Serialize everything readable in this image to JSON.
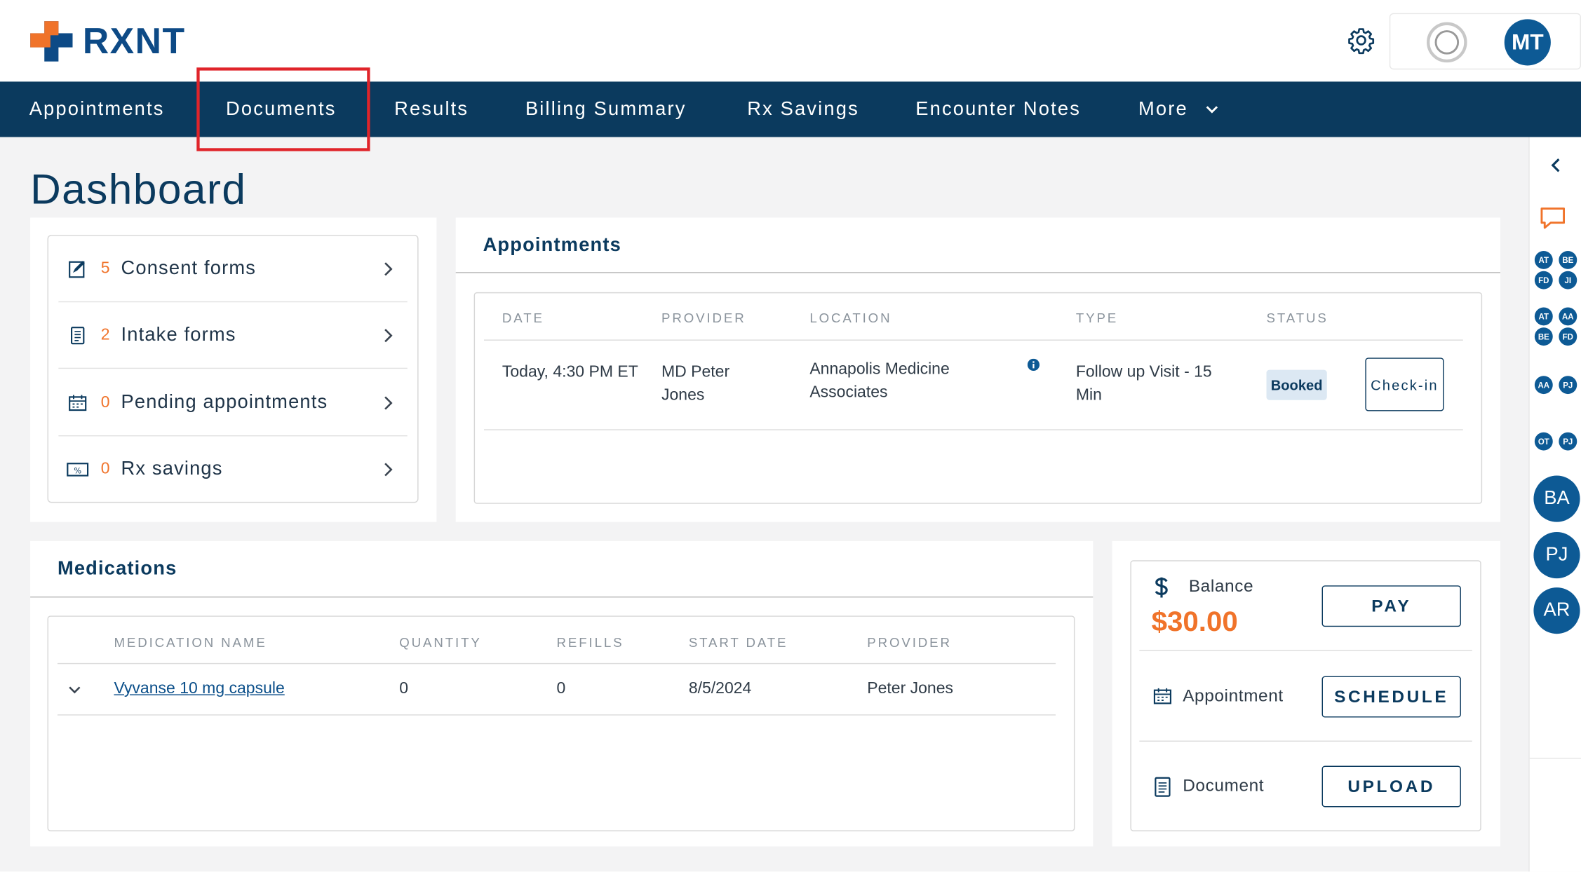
{
  "header": {
    "logo_text": "RXNT",
    "avatar_initials": "MT"
  },
  "nav": {
    "items": [
      {
        "label": "Appointments"
      },
      {
        "label": "Documents"
      },
      {
        "label": "Results"
      },
      {
        "label": "Billing Summary"
      },
      {
        "label": "Rx Savings"
      },
      {
        "label": "Encounter Notes"
      },
      {
        "label": "More"
      }
    ],
    "highlighted": "Documents"
  },
  "page": {
    "title": "Dashboard"
  },
  "summary": {
    "items": [
      {
        "count": "5",
        "label": "Consent forms",
        "icon": "consent-form-icon"
      },
      {
        "count": "2",
        "label": "Intake forms",
        "icon": "intake-form-icon"
      },
      {
        "count": "0",
        "label": "Pending appointments",
        "icon": "calendar-icon"
      },
      {
        "count": "0",
        "label": "Rx savings",
        "icon": "rx-savings-icon"
      }
    ]
  },
  "appointments": {
    "title": "Appointments",
    "columns": [
      "DATE",
      "PROVIDER",
      "LOCATION",
      "TYPE",
      "STATUS"
    ],
    "rows": [
      {
        "date": "Today, 4:30 PM ET",
        "provider": "MD Peter Jones",
        "location": "Annapolis Medicine Associates",
        "type": "Follow up Visit - 15 Min",
        "status": "Booked",
        "action": "Check-in"
      }
    ]
  },
  "medications": {
    "title": "Medications",
    "columns": [
      "MEDICATION NAME",
      "QUANTITY",
      "REFILLS",
      "START DATE",
      "PROVIDER"
    ],
    "rows": [
      {
        "name": "Vyvanse 10 mg capsule",
        "quantity": "0",
        "refills": "0",
        "start_date": "8/5/2024",
        "provider": "Peter Jones"
      }
    ]
  },
  "actions": {
    "balance_label": "Balance",
    "balance_amount": "$30.00",
    "pay_label": "PAY",
    "appointment_label": "Appointment",
    "schedule_label": "SCHEDULE",
    "document_label": "Document",
    "upload_label": "UPLOAD"
  },
  "rail": {
    "group1": [
      "AT",
      "BE",
      "FD",
      "JI"
    ],
    "group2": [
      "AT",
      "AA",
      "BE",
      "FD"
    ],
    "pair1": [
      "AA",
      "PJ"
    ],
    "pair2": [
      "OT",
      "PJ"
    ],
    "large": [
      "BA",
      "PJ",
      "AR"
    ]
  },
  "colors": {
    "nav_bg": "#0b3a5e",
    "brand_blue": "#0d4a86",
    "accent_orange": "#f0732a",
    "highlight_red": "#e0242a"
  }
}
